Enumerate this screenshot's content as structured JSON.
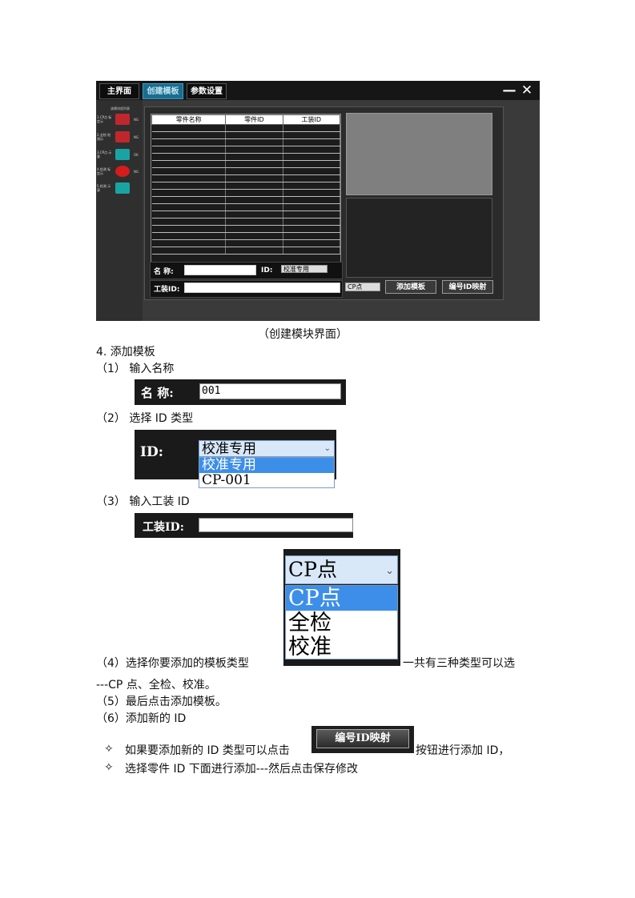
{
  "app": {
    "tabs": [
      "主界面",
      "创建模板",
      "参数设置"
    ],
    "active_tab": 1,
    "window_buttons": {
      "minimize": "—",
      "close": "✕"
    },
    "sidebar_title": "该模块组列表",
    "sidebar_items": [
      {
        "label": "1.CP点 标定示",
        "icon_color": "#c0272d",
        "mark": "NG"
      },
      {
        "label": "2.全检 检测示",
        "icon_color": "#c0272d",
        "mark": "NG"
      },
      {
        "label": "3.CP点 示意",
        "icon_color": "#1aa3a3",
        "mark": "OK"
      },
      {
        "label": "4.检测 标定示",
        "icon_color": "#d41c1c",
        "mark": "NG"
      },
      {
        "label": "5.检测 示意",
        "icon_color": "#1aa3a3",
        "mark": ""
      }
    ],
    "table_headers": [
      "零件名称",
      "零件ID",
      "工装ID"
    ],
    "table_row_count": 18,
    "name_label": "名  称:",
    "id_label": "ID:",
    "id_select_value": "校准专用",
    "fixture_label": "工装ID:",
    "type_select_value": "CP点",
    "add_template_button": "添加模板",
    "map_id_button": "编号ID映射"
  },
  "caption": "（创建模块界面）",
  "section_title": "4. 添加模板",
  "step1": {
    "text": "（1）  输入名称",
    "crop_label": "名  称:",
    "crop_value": "001"
  },
  "step2": {
    "text": "（2）  选择 ID 类型",
    "crop_label": "ID:",
    "select_value": "校准专用",
    "options": [
      "校准专用",
      "CP-001"
    ]
  },
  "step3": {
    "text": "（3）  输入工装 ID",
    "crop_label": "工装ID:"
  },
  "type_dropdown": {
    "value": "CP点",
    "options": [
      "CP点",
      "全检",
      "校准"
    ]
  },
  "step4": {
    "text_before": "（4）选择你要添加的模板类型",
    "text_after": "一共有三种类型可以选",
    "text_line2": "---CP 点、全检、校准。"
  },
  "step5": {
    "text": "（5）最后点击添加模板。"
  },
  "step6": {
    "text": "（6）添加新的 ID"
  },
  "bullet1": {
    "symbol": "✧",
    "text_before": "如果要添加新的 ID 类型可以点击",
    "button": "编号ID映射",
    "text_after": "按钮进行添加 ID，"
  },
  "bullet2": {
    "symbol": "✧",
    "text": "选择零件 ID 下面进行添加---然后点击保存修改"
  }
}
